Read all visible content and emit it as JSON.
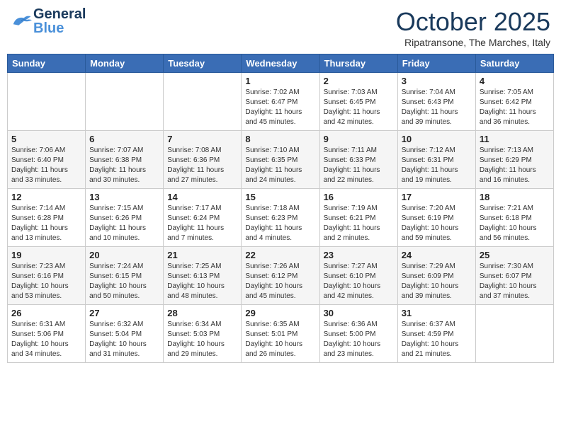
{
  "header": {
    "logo": {
      "line1": "General",
      "line2": "Blue"
    },
    "month": "October 2025",
    "location": "Ripatransone, The Marches, Italy"
  },
  "days_of_week": [
    "Sunday",
    "Monday",
    "Tuesday",
    "Wednesday",
    "Thursday",
    "Friday",
    "Saturday"
  ],
  "weeks": [
    [
      {
        "num": "",
        "info": ""
      },
      {
        "num": "",
        "info": ""
      },
      {
        "num": "",
        "info": ""
      },
      {
        "num": "1",
        "info": "Sunrise: 7:02 AM\nSunset: 6:47 PM\nDaylight: 11 hours and 45 minutes."
      },
      {
        "num": "2",
        "info": "Sunrise: 7:03 AM\nSunset: 6:45 PM\nDaylight: 11 hours and 42 minutes."
      },
      {
        "num": "3",
        "info": "Sunrise: 7:04 AM\nSunset: 6:43 PM\nDaylight: 11 hours and 39 minutes."
      },
      {
        "num": "4",
        "info": "Sunrise: 7:05 AM\nSunset: 6:42 PM\nDaylight: 11 hours and 36 minutes."
      }
    ],
    [
      {
        "num": "5",
        "info": "Sunrise: 7:06 AM\nSunset: 6:40 PM\nDaylight: 11 hours and 33 minutes."
      },
      {
        "num": "6",
        "info": "Sunrise: 7:07 AM\nSunset: 6:38 PM\nDaylight: 11 hours and 30 minutes."
      },
      {
        "num": "7",
        "info": "Sunrise: 7:08 AM\nSunset: 6:36 PM\nDaylight: 11 hours and 27 minutes."
      },
      {
        "num": "8",
        "info": "Sunrise: 7:10 AM\nSunset: 6:35 PM\nDaylight: 11 hours and 24 minutes."
      },
      {
        "num": "9",
        "info": "Sunrise: 7:11 AM\nSunset: 6:33 PM\nDaylight: 11 hours and 22 minutes."
      },
      {
        "num": "10",
        "info": "Sunrise: 7:12 AM\nSunset: 6:31 PM\nDaylight: 11 hours and 19 minutes."
      },
      {
        "num": "11",
        "info": "Sunrise: 7:13 AM\nSunset: 6:29 PM\nDaylight: 11 hours and 16 minutes."
      }
    ],
    [
      {
        "num": "12",
        "info": "Sunrise: 7:14 AM\nSunset: 6:28 PM\nDaylight: 11 hours and 13 minutes."
      },
      {
        "num": "13",
        "info": "Sunrise: 7:15 AM\nSunset: 6:26 PM\nDaylight: 11 hours and 10 minutes."
      },
      {
        "num": "14",
        "info": "Sunrise: 7:17 AM\nSunset: 6:24 PM\nDaylight: 11 hours and 7 minutes."
      },
      {
        "num": "15",
        "info": "Sunrise: 7:18 AM\nSunset: 6:23 PM\nDaylight: 11 hours and 4 minutes."
      },
      {
        "num": "16",
        "info": "Sunrise: 7:19 AM\nSunset: 6:21 PM\nDaylight: 11 hours and 2 minutes."
      },
      {
        "num": "17",
        "info": "Sunrise: 7:20 AM\nSunset: 6:19 PM\nDaylight: 10 hours and 59 minutes."
      },
      {
        "num": "18",
        "info": "Sunrise: 7:21 AM\nSunset: 6:18 PM\nDaylight: 10 hours and 56 minutes."
      }
    ],
    [
      {
        "num": "19",
        "info": "Sunrise: 7:23 AM\nSunset: 6:16 PM\nDaylight: 10 hours and 53 minutes."
      },
      {
        "num": "20",
        "info": "Sunrise: 7:24 AM\nSunset: 6:15 PM\nDaylight: 10 hours and 50 minutes."
      },
      {
        "num": "21",
        "info": "Sunrise: 7:25 AM\nSunset: 6:13 PM\nDaylight: 10 hours and 48 minutes."
      },
      {
        "num": "22",
        "info": "Sunrise: 7:26 AM\nSunset: 6:12 PM\nDaylight: 10 hours and 45 minutes."
      },
      {
        "num": "23",
        "info": "Sunrise: 7:27 AM\nSunset: 6:10 PM\nDaylight: 10 hours and 42 minutes."
      },
      {
        "num": "24",
        "info": "Sunrise: 7:29 AM\nSunset: 6:09 PM\nDaylight: 10 hours and 39 minutes."
      },
      {
        "num": "25",
        "info": "Sunrise: 7:30 AM\nSunset: 6:07 PM\nDaylight: 10 hours and 37 minutes."
      }
    ],
    [
      {
        "num": "26",
        "info": "Sunrise: 6:31 AM\nSunset: 5:06 PM\nDaylight: 10 hours and 34 minutes."
      },
      {
        "num": "27",
        "info": "Sunrise: 6:32 AM\nSunset: 5:04 PM\nDaylight: 10 hours and 31 minutes."
      },
      {
        "num": "28",
        "info": "Sunrise: 6:34 AM\nSunset: 5:03 PM\nDaylight: 10 hours and 29 minutes."
      },
      {
        "num": "29",
        "info": "Sunrise: 6:35 AM\nSunset: 5:01 PM\nDaylight: 10 hours and 26 minutes."
      },
      {
        "num": "30",
        "info": "Sunrise: 6:36 AM\nSunset: 5:00 PM\nDaylight: 10 hours and 23 minutes."
      },
      {
        "num": "31",
        "info": "Sunrise: 6:37 AM\nSunset: 4:59 PM\nDaylight: 10 hours and 21 minutes."
      },
      {
        "num": "",
        "info": ""
      }
    ]
  ]
}
